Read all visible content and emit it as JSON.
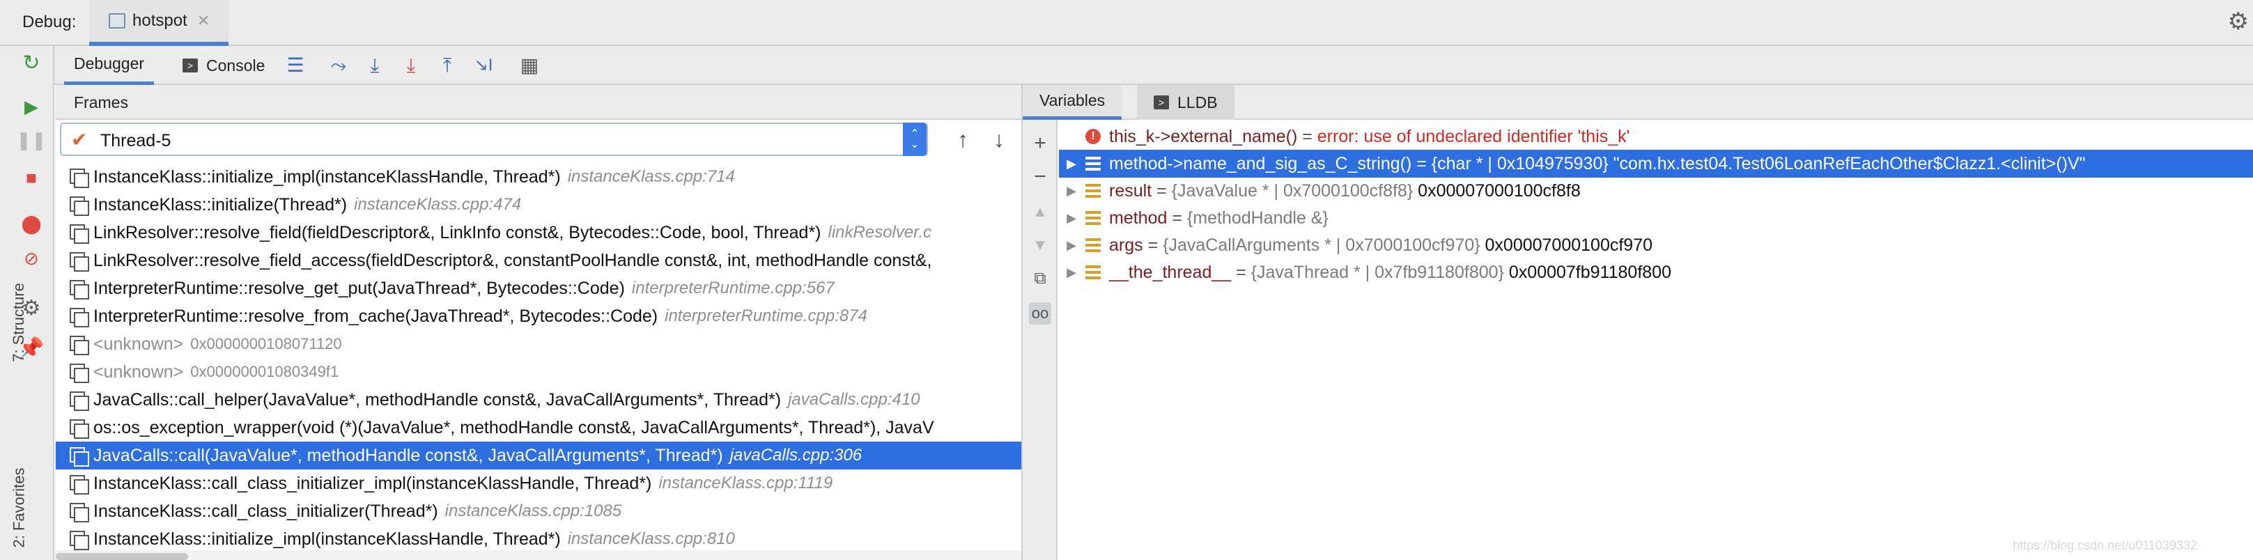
{
  "window": {
    "debug_label": "Debug:",
    "run_tab": "hotspot"
  },
  "left_stripe": {
    "structure_label": "7: Structure",
    "favorites_label": "2: Favorites"
  },
  "toolbar": {
    "debugger_tab": "Debugger",
    "console_tab": "Console"
  },
  "frames": {
    "header": "Frames",
    "thread": "Thread-5",
    "rows": [
      {
        "fn": "InstanceKlass::initialize_impl(instanceKlassHandle, Thread*)",
        "loc": "instanceKlass.cpp:714"
      },
      {
        "fn": "InstanceKlass::initialize(Thread*)",
        "loc": "instanceKlass.cpp:474"
      },
      {
        "fn": "LinkResolver::resolve_field(fieldDescriptor&, LinkInfo const&, Bytecodes::Code, bool, Thread*)",
        "loc": "linkResolver.c"
      },
      {
        "fn": "LinkResolver::resolve_field_access(fieldDescriptor&, constantPoolHandle const&, int, methodHandle const&,",
        "loc": ""
      },
      {
        "fn": "InterpreterRuntime::resolve_get_put(JavaThread*, Bytecodes::Code)",
        "loc": "interpreterRuntime.cpp:567"
      },
      {
        "fn": "InterpreterRuntime::resolve_from_cache(JavaThread*, Bytecodes::Code)",
        "loc": "interpreterRuntime.cpp:874"
      },
      {
        "fn": "<unknown>",
        "loc": "0x0000000108071120",
        "unknown": true
      },
      {
        "fn": "<unknown>",
        "loc": "0x00000001080349f1",
        "unknown": true
      },
      {
        "fn": "JavaCalls::call_helper(JavaValue*, methodHandle const&, JavaCallArguments*, Thread*)",
        "loc": "javaCalls.cpp:410"
      },
      {
        "fn": "os::os_exception_wrapper(void (*)(JavaValue*, methodHandle const&, JavaCallArguments*, Thread*), JavaV",
        "loc": ""
      },
      {
        "fn": "JavaCalls::call(JavaValue*, methodHandle const&, JavaCallArguments*, Thread*)",
        "loc": "javaCalls.cpp:306",
        "selected": true
      },
      {
        "fn": "InstanceKlass::call_class_initializer_impl(instanceKlassHandle, Thread*)",
        "loc": "instanceKlass.cpp:1119"
      },
      {
        "fn": "InstanceKlass::call_class_initializer(Thread*)",
        "loc": "instanceKlass.cpp:1085"
      },
      {
        "fn": "InstanceKlass::initialize_impl(instanceKlassHandle, Thread*)",
        "loc": "instanceKlass.cpp:810"
      }
    ]
  },
  "variables": {
    "tab_variables": "Variables",
    "tab_lldb": "LLDB",
    "rows": [
      {
        "kind": "error",
        "name": "this_k->external_name()",
        "eq": " = ",
        "type": "",
        "value": "error: use of undeclared identifier 'this_k'"
      },
      {
        "kind": "var",
        "name": "method->name_and_sig_as_C_string()",
        "eq": " = ",
        "type": "{char * | 0x104975930}",
        "value": " \"com.hx.test04.Test06LoanRefEachOther$Clazz1.<clinit>()V\"",
        "selected": true
      },
      {
        "kind": "var",
        "name": "result",
        "eq": " = ",
        "type": "{JavaValue * | 0x7000100cf8f8}",
        "value": " 0x00007000100cf8f8"
      },
      {
        "kind": "var",
        "name": "method",
        "eq": " = ",
        "type": "{methodHandle &}",
        "value": ""
      },
      {
        "kind": "var",
        "name": "args",
        "eq": " = ",
        "type": "{JavaCallArguments * | 0x7000100cf970}",
        "value": " 0x00007000100cf970"
      },
      {
        "kind": "var",
        "name": "__the_thread__",
        "eq": " = ",
        "type": "{JavaThread * | 0x7fb91180f800}",
        "value": " 0x00007fb91180f800"
      }
    ]
  },
  "colors": {
    "selection": "#2d6fe0",
    "accent": "#4c7fd1",
    "error": "#cc2a22",
    "var_name": "#7a1f1f"
  }
}
